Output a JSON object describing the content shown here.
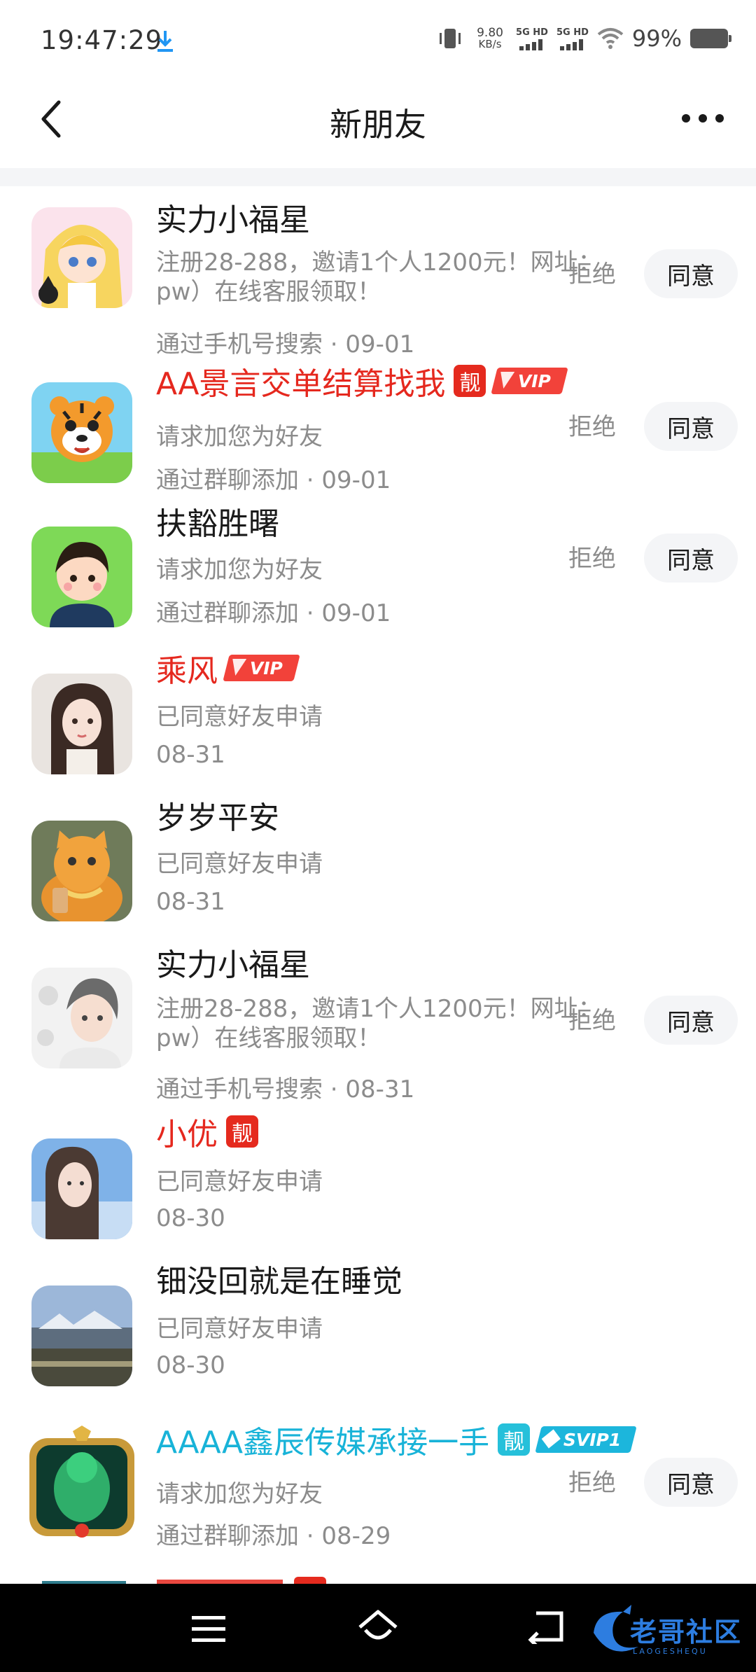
{
  "status_bar": {
    "time": "19:47:29",
    "net_speed_value": "9.80",
    "net_speed_unit": "KB/s",
    "signal_1": "5G HD",
    "signal_2": "5G HD",
    "battery": "99%"
  },
  "header": {
    "title": "新朋友"
  },
  "requests": [
    {
      "name": "实力小福星",
      "name_color": "default",
      "message": "注册28-288，邀请1个人1200元！网址：pw）在线客服领取！",
      "source": "通过手机号搜索 · 09-01",
      "reject_label": "拒绝",
      "agree_label": "同意"
    },
    {
      "name": "AA景言交单结算找我",
      "name_color": "red",
      "badge": "靓",
      "vip": "VIP",
      "message": "请求加您为好友",
      "source": "通过群聊添加 · 09-01",
      "reject_label": "拒绝",
      "agree_label": "同意"
    },
    {
      "name": "扶豁胜曙",
      "name_color": "default",
      "message": "请求加您为好友",
      "source": "通过群聊添加 · 09-01",
      "reject_label": "拒绝",
      "agree_label": "同意"
    },
    {
      "name": "乘风",
      "name_color": "red",
      "vip": "VIP",
      "message": "已同意好友申请",
      "source": "08-31"
    },
    {
      "name": "岁岁平安",
      "name_color": "default",
      "message": "已同意好友申请",
      "source": "08-31"
    },
    {
      "name": "实力小福星",
      "name_color": "default",
      "message": "注册28-288，邀请1个人1200元！网址：pw）在线客服领取！",
      "source": "通过手机号搜索 · 08-31",
      "reject_label": "拒绝",
      "agree_label": "同意"
    },
    {
      "name": "小优",
      "name_color": "red",
      "badge": "靓",
      "message": "已同意好友申请",
      "source": "08-30"
    },
    {
      "name": "钿没回就是在睡觉",
      "name_color": "default",
      "message": "已同意好友申请",
      "source": "08-30"
    },
    {
      "name": "AAAA鑫辰传媒承接一手",
      "name_color": "cyan",
      "badge": "靓",
      "vip": "SVIP1",
      "message": "请求加您为好友",
      "source": "通过群聊添加 · 08-29",
      "reject_label": "拒绝",
      "agree_label": "同意"
    }
  ],
  "watermark": {
    "title": "老哥社区",
    "subtitle": "LAOGESHEQU"
  },
  "colors": {
    "accent_red": "#e5281e",
    "accent_cyan": "#18b3d8",
    "secondary_text": "#8c8c8c",
    "button_bg": "#f4f5f7"
  }
}
